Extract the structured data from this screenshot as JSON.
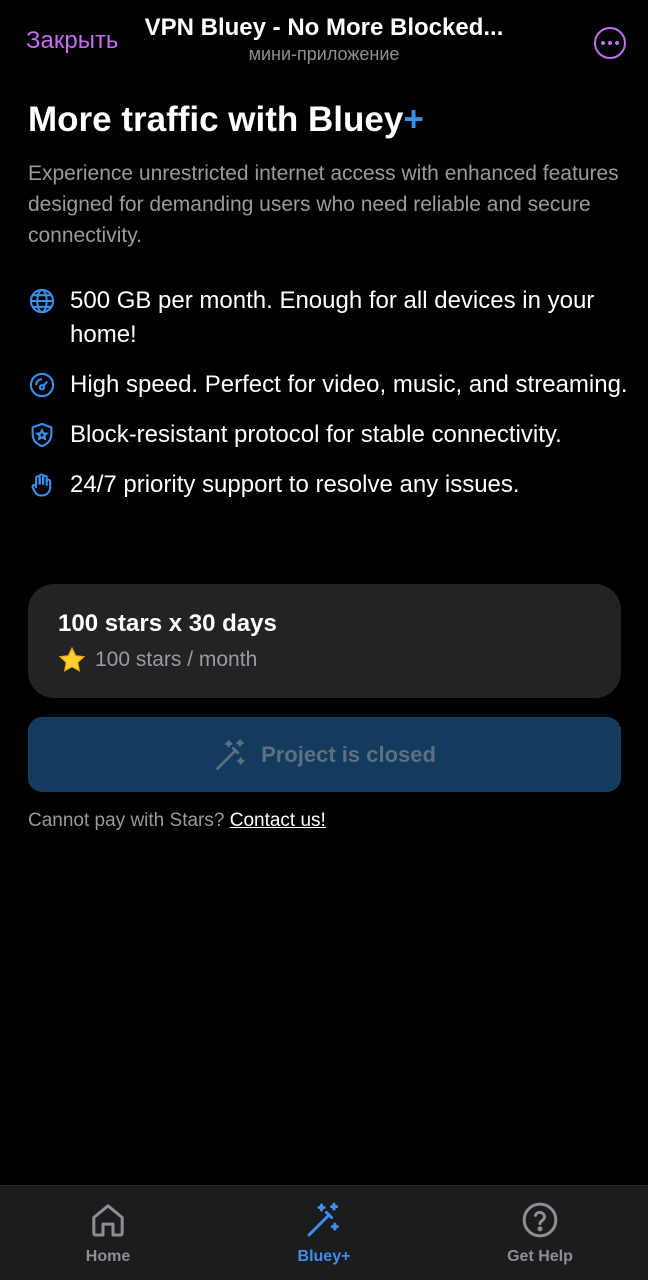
{
  "header": {
    "close_label": "Закрыть",
    "title": "VPN Bluey - No More Blocked...",
    "subtitle": "мини-приложение",
    "more_icon": "ellipsis-circle-icon"
  },
  "hero": {
    "title": "More traffic with Bluey",
    "title_plus": "+",
    "description": "Experience unrestricted internet access with enhanced features designed for demanding users who need reliable and secure connectivity."
  },
  "features": [
    {
      "icon": "globe-icon",
      "text": "500 GB per month. Enough for all devices in your home!"
    },
    {
      "icon": "speedometer-icon",
      "text": "High speed. Perfect for video, music, and streaming."
    },
    {
      "icon": "shield-star-icon",
      "text": "Block-resistant protocol for stable connectivity."
    },
    {
      "icon": "hand-support-icon",
      "text": "24/7 priority support to resolve any issues."
    }
  ],
  "plan": {
    "title": "100 stars x 30 days",
    "price": "100 stars / month",
    "price_icon": "star-icon"
  },
  "cta": {
    "label": "Project is closed",
    "icon": "magic-wand-icon"
  },
  "contact": {
    "text": "Cannot pay with Stars?",
    "link": "Contact us!"
  },
  "tabs": [
    {
      "label": "Home",
      "icon": "home-icon",
      "active": false
    },
    {
      "label": "Bluey+",
      "icon": "magic-wand-icon",
      "active": true
    },
    {
      "label": "Get Help",
      "icon": "help-circle-icon",
      "active": false
    }
  ],
  "colors": {
    "accent": "#3b8ff0",
    "telegram_purple": "#c46ef0",
    "background": "#000000",
    "card": "#232325",
    "button_disabled": "#123b5e"
  }
}
